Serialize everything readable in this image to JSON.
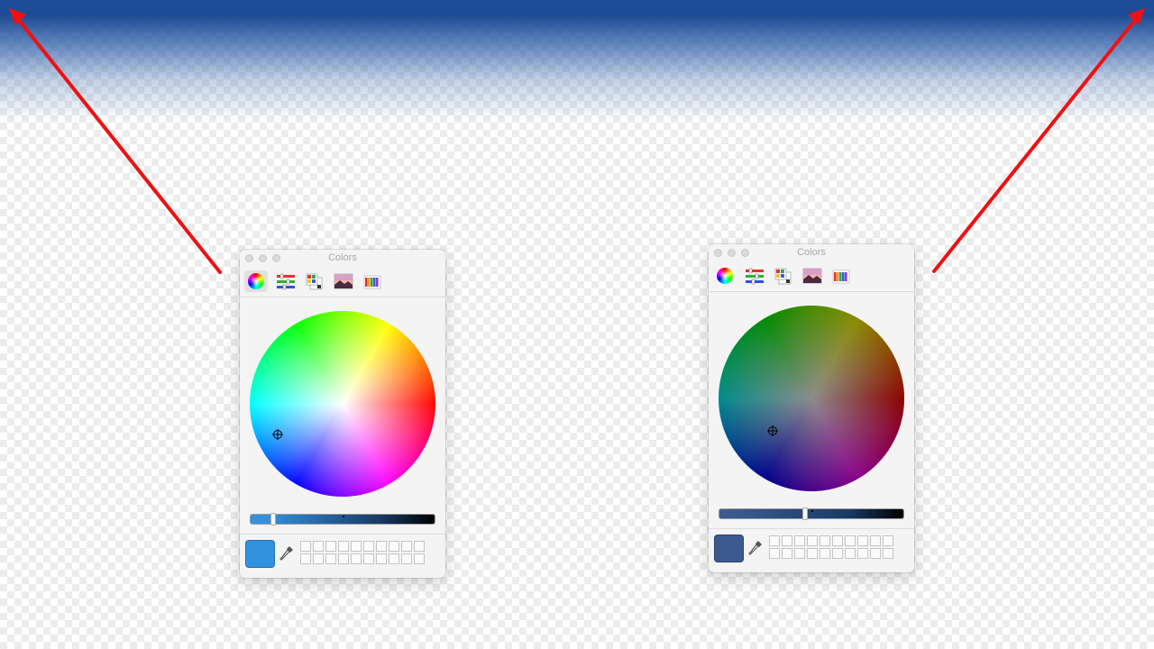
{
  "panels": [
    {
      "title": "Colors",
      "selected_color": "#3392e0",
      "brightness": 0.12,
      "wheel": "bright",
      "toolbar": [
        "color-wheel-icon",
        "sliders-icon",
        "palettes-icon",
        "image-palettes-icon",
        "pencils-icon"
      ],
      "toolbar_active": 0
    },
    {
      "title": "Colors",
      "selected_color": "#3c5a8e",
      "brightness": 0.46,
      "wheel": "dim",
      "toolbar": [
        "color-wheel-icon",
        "sliders-icon",
        "palettes-icon",
        "image-palettes-icon",
        "pencils-icon"
      ],
      "toolbar_active": -1
    }
  ],
  "annotation": {
    "arrow_color": "#ee1111"
  },
  "colors": {
    "top_gradient": "#1d4a94",
    "panel_background": "#f4f4f4"
  }
}
